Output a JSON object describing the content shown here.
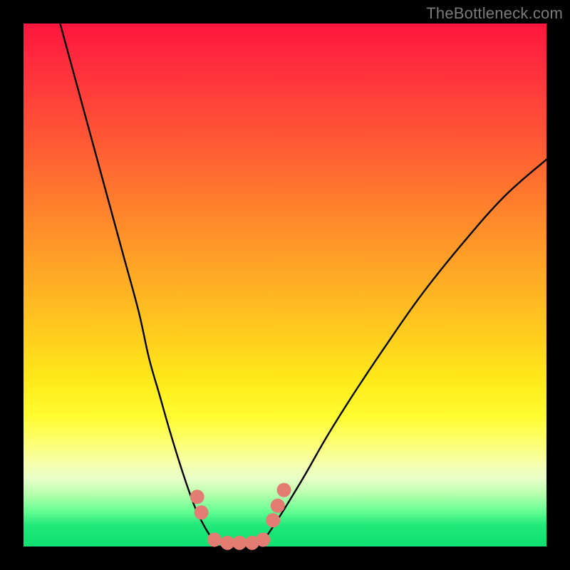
{
  "watermark": "TheBottleneck.com",
  "colors": {
    "page_bg": "#000000",
    "watermark": "#7b7b7b",
    "curve": "#000000",
    "markers": "#e37d74",
    "gradient_top": "#ff163e",
    "gradient_bottom": "#0ee070"
  },
  "chart_data": {
    "type": "line",
    "title": "",
    "xlabel": "",
    "ylabel": "",
    "xlim": [
      0,
      100
    ],
    "ylim": [
      0,
      100
    ],
    "series": [
      {
        "name": "curve-left",
        "x": [
          7,
          10,
          13,
          16,
          19,
          22,
          24,
          26,
          28,
          30,
          31.5,
          33,
          34.5,
          35.7,
          37
        ],
        "y": [
          100,
          89,
          78,
          67,
          56,
          45,
          36,
          29,
          22,
          15.5,
          11,
          7,
          4,
          2,
          0
        ]
      },
      {
        "name": "curve-bottom",
        "x": [
          37,
          40,
          43,
          45
        ],
        "y": [
          0,
          0,
          0,
          0
        ]
      },
      {
        "name": "curve-right",
        "x": [
          45,
          46.5,
          48.5,
          51,
          54,
          58,
          63,
          69,
          76,
          84,
          92,
          100
        ],
        "y": [
          0,
          2,
          5,
          9,
          14,
          21,
          29,
          38,
          48,
          58,
          67,
          74
        ]
      }
    ],
    "markers": {
      "name": "highlighted-points",
      "points": [
        {
          "x": 33.2,
          "y": 9.5
        },
        {
          "x": 34.0,
          "y": 6.5
        },
        {
          "x": 36.5,
          "y": 1.3
        },
        {
          "x": 39.0,
          "y": 0.7
        },
        {
          "x": 41.3,
          "y": 0.7
        },
        {
          "x": 43.7,
          "y": 0.7
        },
        {
          "x": 45.8,
          "y": 1.3
        },
        {
          "x": 47.7,
          "y": 5.0
        },
        {
          "x": 48.6,
          "y": 7.8
        },
        {
          "x": 49.8,
          "y": 10.8
        }
      ],
      "radius_px": 10
    }
  }
}
